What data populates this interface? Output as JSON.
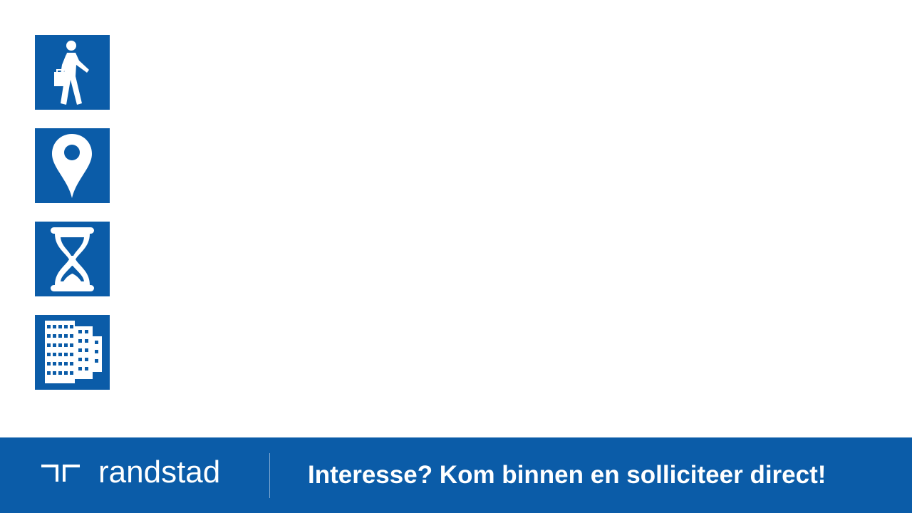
{
  "icons": [
    {
      "name": "walking-person-icon"
    },
    {
      "name": "map-pin-icon"
    },
    {
      "name": "hourglass-icon"
    },
    {
      "name": "buildings-icon"
    }
  ],
  "footer": {
    "logo_text": "randstad",
    "cta_text": "Interesse? Kom binnen en solliciteer direct!"
  },
  "colors": {
    "brand_blue": "#0b5ca8",
    "text_white": "#ffffff",
    "background": "#ffffff"
  }
}
